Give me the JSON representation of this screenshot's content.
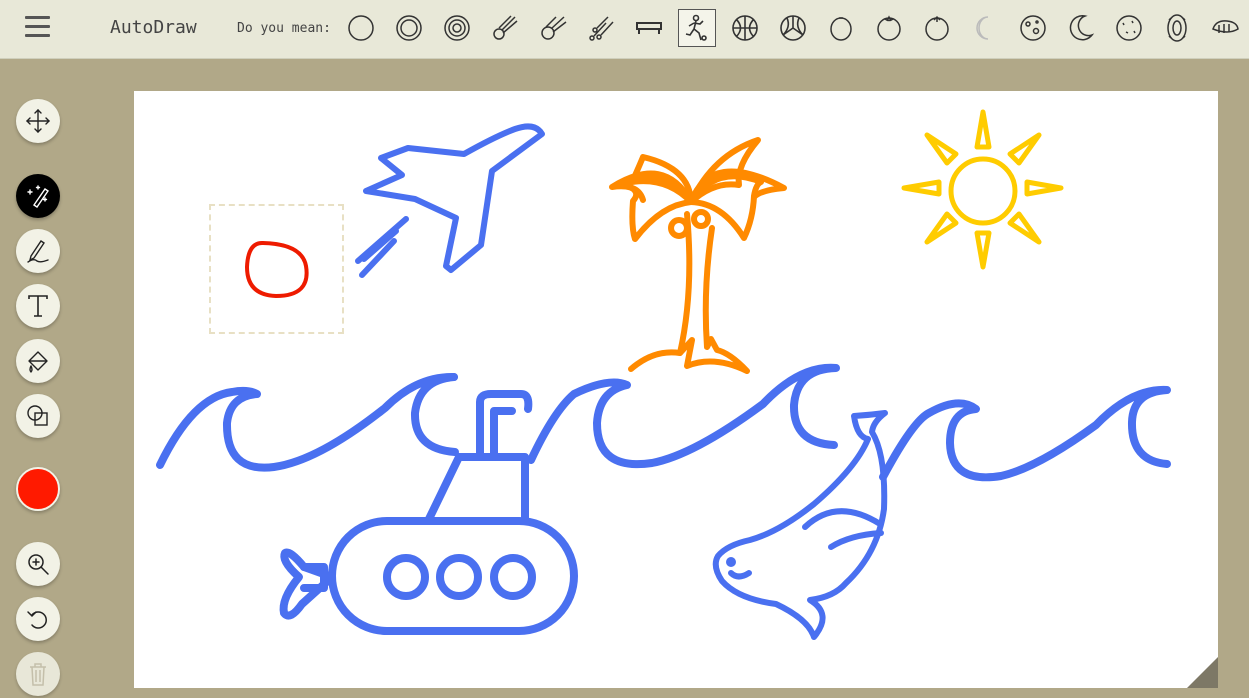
{
  "app": {
    "title": "AutoDraw"
  },
  "suggestions": {
    "label": "Do you mean:",
    "items": [
      {
        "name": "circle"
      },
      {
        "name": "ring"
      },
      {
        "name": "target"
      },
      {
        "name": "comet"
      },
      {
        "name": "meteor"
      },
      {
        "name": "meteor-shower"
      },
      {
        "name": "bench"
      },
      {
        "name": "soccer-player",
        "selected": true
      },
      {
        "name": "basketball"
      },
      {
        "name": "volleyball"
      },
      {
        "name": "egg"
      },
      {
        "name": "orange"
      },
      {
        "name": "tomato"
      },
      {
        "name": "crescent"
      },
      {
        "name": "moon"
      },
      {
        "name": "moon-crescent"
      },
      {
        "name": "cookie"
      },
      {
        "name": "tire"
      },
      {
        "name": "whale"
      }
    ]
  },
  "tools": [
    {
      "name": "move-tool",
      "icon": "move-icon"
    },
    {
      "name": "autodraw-tool",
      "icon": "autodraw-icon",
      "active": true
    },
    {
      "name": "draw-tool",
      "icon": "pencil-icon"
    },
    {
      "name": "type-tool",
      "icon": "text-icon"
    },
    {
      "name": "fill-tool",
      "icon": "paint-bucket-icon"
    },
    {
      "name": "shape-tool",
      "icon": "shapes-icon"
    },
    {
      "name": "color-picker",
      "icon": "color-swatch",
      "color": "#ff1a00"
    },
    {
      "name": "zoom-tool",
      "icon": "zoom-in-icon"
    },
    {
      "name": "undo-button",
      "icon": "undo-icon"
    },
    {
      "name": "delete-button",
      "icon": "trash-icon"
    }
  ],
  "colors": {
    "background": "#b1a888",
    "topbar": "#e8e8d8",
    "stroke_blue": "#4a70f0",
    "stroke_orange": "#ff8a00",
    "stroke_yellow": "#ffcc00",
    "stroke_red": "#ee1b00",
    "active_color": "#ff1a00"
  },
  "canvas": {
    "drawings": [
      "airplane",
      "palm-tree",
      "sun",
      "waves",
      "submarine",
      "seal",
      "scribble"
    ]
  }
}
